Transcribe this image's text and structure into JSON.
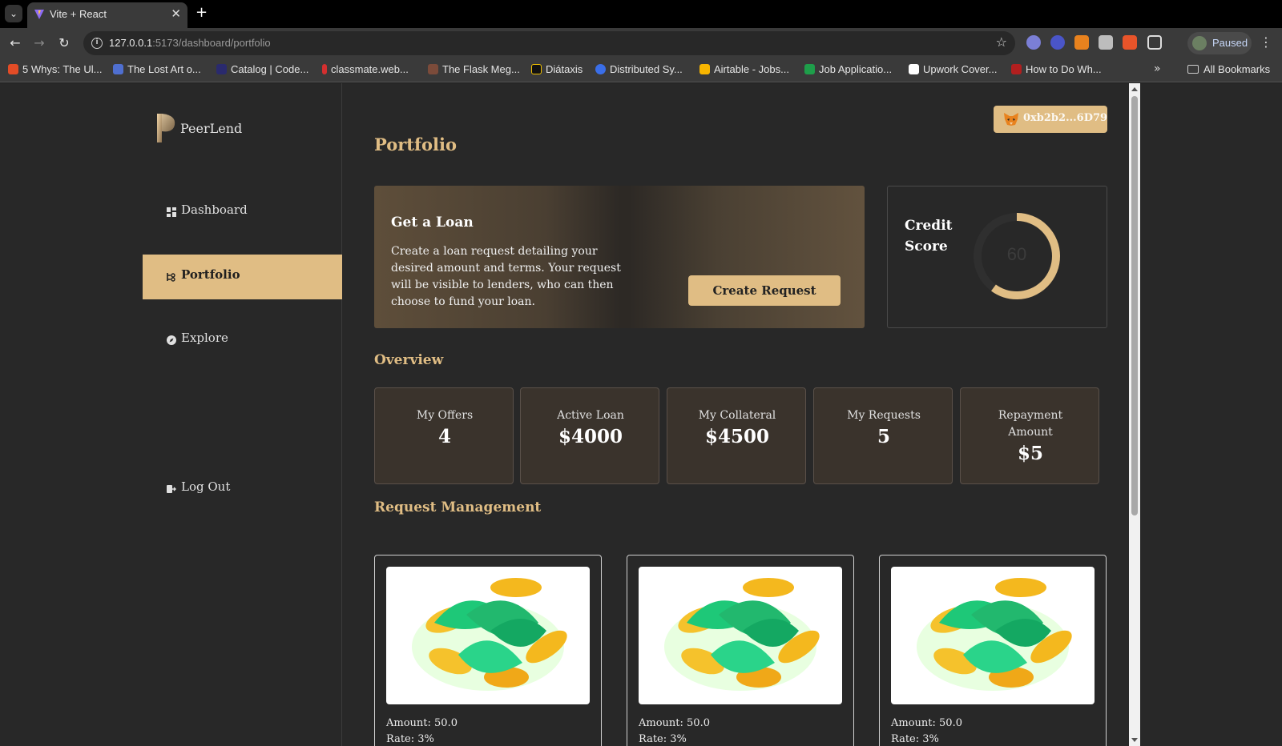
{
  "browser": {
    "tab_title": "Vite + React",
    "url_host": "127.0.0.1",
    "url_path": ":5173/dashboard/portfolio",
    "profile_status": "Paused",
    "bookmarks": [
      {
        "label": "5 Whys: The Ul...",
        "color": "#e34c26"
      },
      {
        "label": "The Lost Art o...",
        "color": "#4f6fd0"
      },
      {
        "label": "Catalog | Code...",
        "color": "#2a2a6e"
      },
      {
        "label": "classmate.web...",
        "color": "#d32f2f"
      },
      {
        "label": "The Flask Meg...",
        "color": "#7b4b3a"
      },
      {
        "label": "Diátaxis",
        "color": "#111111"
      },
      {
        "label": "Distributed Sy...",
        "color": "#3a6ee8"
      },
      {
        "label": "Airtable - Jobs...",
        "color": "#f7b500"
      },
      {
        "label": "Job Applicatio...",
        "color": "#1e9e4a"
      },
      {
        "label": "Upwork Cover...",
        "color": "#ffffff"
      },
      {
        "label": "How to Do Wh...",
        "color": "#b21f1f"
      }
    ],
    "all_bookmarks": "All Bookmarks"
  },
  "sidebar": {
    "logo_text": "PeerLend",
    "nav": [
      {
        "label": "Dashboard",
        "icon": "dashboard-icon"
      },
      {
        "label": "Portfolio",
        "icon": "portfolio-icon",
        "active": true
      },
      {
        "label": "Explore",
        "icon": "compass-icon"
      }
    ],
    "logout": "Log Out"
  },
  "header": {
    "wallet_address": "0xb2b2...6D79"
  },
  "page_title": "Portfolio",
  "loan_card": {
    "title": "Get a Loan",
    "description": "Create a loan request detailing your desired amount and terms. Your request will be visible to lenders, who can then choose to fund your loan.",
    "button": "Create Request"
  },
  "credit": {
    "title": "Credit Score",
    "score": "60",
    "fraction": 0.6,
    "accent": "#e0bd84"
  },
  "overview": {
    "title": "Overview",
    "stats": [
      {
        "label": "My Offers",
        "value": "4"
      },
      {
        "label": "Active Loan",
        "value": "$4000"
      },
      {
        "label": "My Collateral",
        "value": "$4500"
      },
      {
        "label": "My Requests",
        "value": "5"
      },
      {
        "label": "Repayment Amount",
        "value": "$5"
      }
    ]
  },
  "requests": {
    "title": "Request Management",
    "items": [
      {
        "amount": "Amount: 50.0",
        "rate": "Rate: 3%"
      },
      {
        "amount": "Amount: 50.0",
        "rate": "Rate: 3%"
      },
      {
        "amount": "Amount: 50.0",
        "rate": "Rate: 3%"
      }
    ]
  },
  "colors": {
    "accent": "#e0bd84",
    "background": "#282828"
  }
}
